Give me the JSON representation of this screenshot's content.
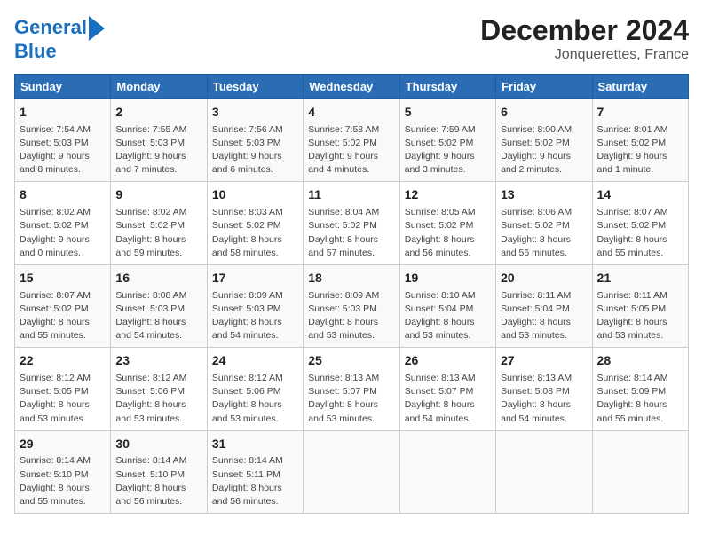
{
  "logo": {
    "line1": "General",
    "line2": "Blue"
  },
  "title": "December 2024",
  "subtitle": "Jonquerettes, France",
  "days_of_week": [
    "Sunday",
    "Monday",
    "Tuesday",
    "Wednesday",
    "Thursday",
    "Friday",
    "Saturday"
  ],
  "weeks": [
    [
      {
        "day": 1,
        "info": "Sunrise: 7:54 AM\nSunset: 5:03 PM\nDaylight: 9 hours\nand 8 minutes."
      },
      {
        "day": 2,
        "info": "Sunrise: 7:55 AM\nSunset: 5:03 PM\nDaylight: 9 hours\nand 7 minutes."
      },
      {
        "day": 3,
        "info": "Sunrise: 7:56 AM\nSunset: 5:03 PM\nDaylight: 9 hours\nand 6 minutes."
      },
      {
        "day": 4,
        "info": "Sunrise: 7:58 AM\nSunset: 5:02 PM\nDaylight: 9 hours\nand 4 minutes."
      },
      {
        "day": 5,
        "info": "Sunrise: 7:59 AM\nSunset: 5:02 PM\nDaylight: 9 hours\nand 3 minutes."
      },
      {
        "day": 6,
        "info": "Sunrise: 8:00 AM\nSunset: 5:02 PM\nDaylight: 9 hours\nand 2 minutes."
      },
      {
        "day": 7,
        "info": "Sunrise: 8:01 AM\nSunset: 5:02 PM\nDaylight: 9 hours\nand 1 minute."
      }
    ],
    [
      {
        "day": 8,
        "info": "Sunrise: 8:02 AM\nSunset: 5:02 PM\nDaylight: 9 hours\nand 0 minutes."
      },
      {
        "day": 9,
        "info": "Sunrise: 8:02 AM\nSunset: 5:02 PM\nDaylight: 8 hours\nand 59 minutes."
      },
      {
        "day": 10,
        "info": "Sunrise: 8:03 AM\nSunset: 5:02 PM\nDaylight: 8 hours\nand 58 minutes."
      },
      {
        "day": 11,
        "info": "Sunrise: 8:04 AM\nSunset: 5:02 PM\nDaylight: 8 hours\nand 57 minutes."
      },
      {
        "day": 12,
        "info": "Sunrise: 8:05 AM\nSunset: 5:02 PM\nDaylight: 8 hours\nand 56 minutes."
      },
      {
        "day": 13,
        "info": "Sunrise: 8:06 AM\nSunset: 5:02 PM\nDaylight: 8 hours\nand 56 minutes."
      },
      {
        "day": 14,
        "info": "Sunrise: 8:07 AM\nSunset: 5:02 PM\nDaylight: 8 hours\nand 55 minutes."
      }
    ],
    [
      {
        "day": 15,
        "info": "Sunrise: 8:07 AM\nSunset: 5:02 PM\nDaylight: 8 hours\nand 55 minutes."
      },
      {
        "day": 16,
        "info": "Sunrise: 8:08 AM\nSunset: 5:03 PM\nDaylight: 8 hours\nand 54 minutes."
      },
      {
        "day": 17,
        "info": "Sunrise: 8:09 AM\nSunset: 5:03 PM\nDaylight: 8 hours\nand 54 minutes."
      },
      {
        "day": 18,
        "info": "Sunrise: 8:09 AM\nSunset: 5:03 PM\nDaylight: 8 hours\nand 53 minutes."
      },
      {
        "day": 19,
        "info": "Sunrise: 8:10 AM\nSunset: 5:04 PM\nDaylight: 8 hours\nand 53 minutes."
      },
      {
        "day": 20,
        "info": "Sunrise: 8:11 AM\nSunset: 5:04 PM\nDaylight: 8 hours\nand 53 minutes."
      },
      {
        "day": 21,
        "info": "Sunrise: 8:11 AM\nSunset: 5:05 PM\nDaylight: 8 hours\nand 53 minutes."
      }
    ],
    [
      {
        "day": 22,
        "info": "Sunrise: 8:12 AM\nSunset: 5:05 PM\nDaylight: 8 hours\nand 53 minutes."
      },
      {
        "day": 23,
        "info": "Sunrise: 8:12 AM\nSunset: 5:06 PM\nDaylight: 8 hours\nand 53 minutes."
      },
      {
        "day": 24,
        "info": "Sunrise: 8:12 AM\nSunset: 5:06 PM\nDaylight: 8 hours\nand 53 minutes."
      },
      {
        "day": 25,
        "info": "Sunrise: 8:13 AM\nSunset: 5:07 PM\nDaylight: 8 hours\nand 53 minutes."
      },
      {
        "day": 26,
        "info": "Sunrise: 8:13 AM\nSunset: 5:07 PM\nDaylight: 8 hours\nand 54 minutes."
      },
      {
        "day": 27,
        "info": "Sunrise: 8:13 AM\nSunset: 5:08 PM\nDaylight: 8 hours\nand 54 minutes."
      },
      {
        "day": 28,
        "info": "Sunrise: 8:14 AM\nSunset: 5:09 PM\nDaylight: 8 hours\nand 55 minutes."
      }
    ],
    [
      {
        "day": 29,
        "info": "Sunrise: 8:14 AM\nSunset: 5:10 PM\nDaylight: 8 hours\nand 55 minutes."
      },
      {
        "day": 30,
        "info": "Sunrise: 8:14 AM\nSunset: 5:10 PM\nDaylight: 8 hours\nand 56 minutes."
      },
      {
        "day": 31,
        "info": "Sunrise: 8:14 AM\nSunset: 5:11 PM\nDaylight: 8 hours\nand 56 minutes."
      },
      null,
      null,
      null,
      null
    ]
  ]
}
